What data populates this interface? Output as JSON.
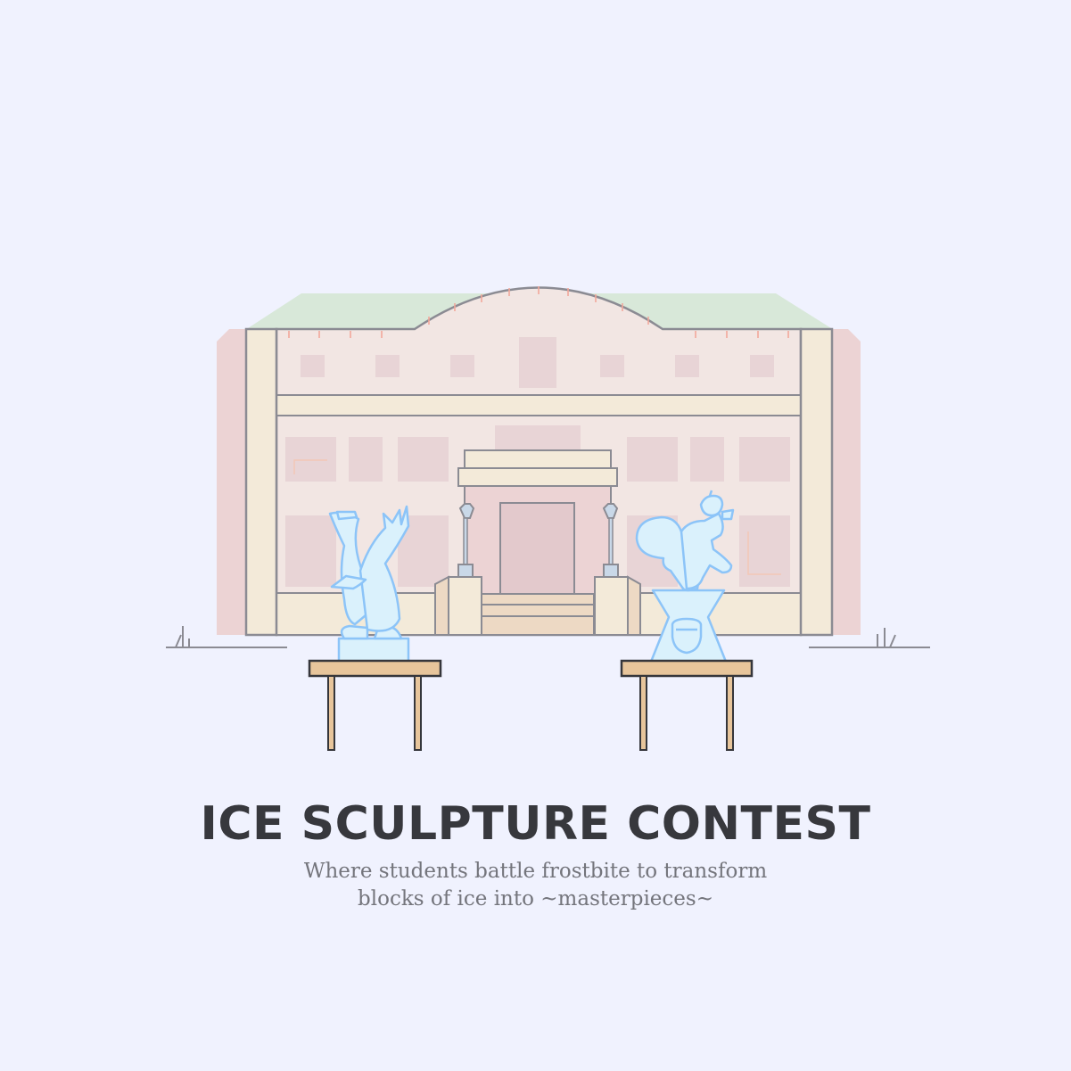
{
  "title": "ICE SCULPTURE CONTEST",
  "subtitle": {
    "line1": "Where students battle frostbite to transform",
    "line2": "blocks of ice into ~masterpieces~"
  },
  "colors": {
    "background": "#f0f2fe",
    "building_wall": "#f2e6e3",
    "building_trim": "#f3ead9",
    "building_outline": "#8b8b93",
    "roof_green": "#d8e8d9",
    "window_pink": "#e8d4d6",
    "ice_fill": "#daf1fc",
    "ice_outline": "#8cc4f8",
    "table_top": "#e7c59b",
    "text_dark": "#37383d",
    "text_muted": "#74757c"
  },
  "scene": {
    "building": "campus-hall",
    "left_sculpture": "bird-ice-sculpture",
    "right_sculpture": "squirrel-ice-sculpture",
    "tables": 2
  }
}
